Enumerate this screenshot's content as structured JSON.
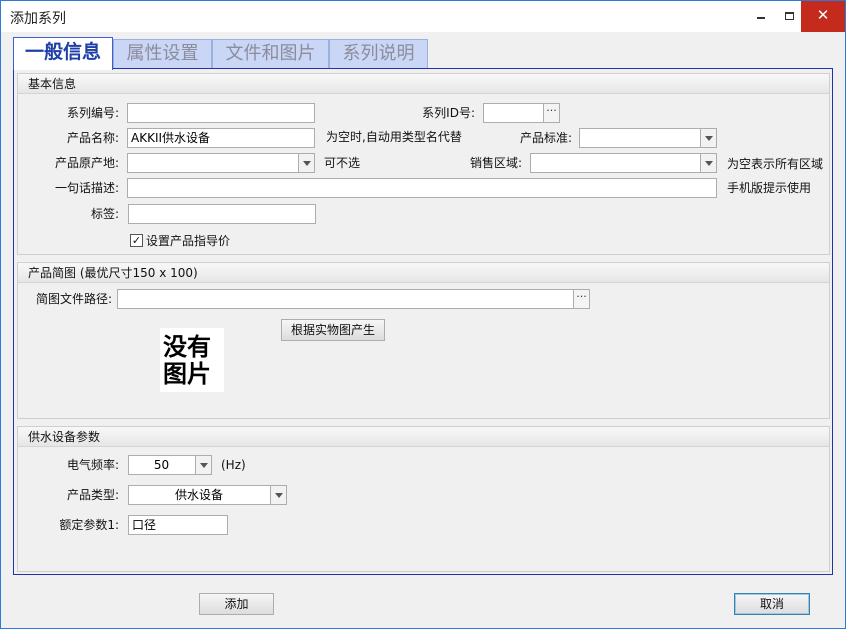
{
  "window": {
    "title": "添加系列",
    "close_glyph": "✕"
  },
  "tabs": [
    {
      "label": "一般信息",
      "active": true
    },
    {
      "label": "属性设置",
      "active": false
    },
    {
      "label": "文件和图片",
      "active": false
    },
    {
      "label": "系列说明",
      "active": false
    }
  ],
  "basic_info": {
    "header": "基本信息",
    "series_code_label": "系列编号:",
    "series_code_value": "",
    "series_id_label": "系列ID号:",
    "series_id_value": "",
    "product_name_label": "产品名称:",
    "product_name_value": "AKKII供水设备",
    "product_name_hint": "为空时,自动用类型名代替",
    "product_standard_label": "产品标准:",
    "product_standard_value": "",
    "origin_label": "产品原产地:",
    "origin_value": "",
    "origin_hint": "可不选",
    "sales_region_label": "销售区域:",
    "sales_region_value": "",
    "sales_region_hint": "为空表示所有区域",
    "one_line_label": "一句话描述:",
    "one_line_value": "",
    "one_line_hint": "手机版提示使用",
    "tag_label": "标签:",
    "tag_value": "",
    "guide_price_label": "设置产品指导价",
    "guide_price_checked": true,
    "check_glyph": "✓",
    "ellipsis": "···"
  },
  "thumbnail": {
    "header": "产品简图 (最优尺寸150 x 100)",
    "path_label": "简图文件路径:",
    "path_value": "",
    "generate_button": "根据实物图产生",
    "placeholder_line1": "没有",
    "placeholder_line2": "图片"
  },
  "water_params": {
    "header": "供水设备参数",
    "frequency_label": "电气频率:",
    "frequency_value": "50",
    "frequency_unit": "(Hz)",
    "product_type_label": "产品类型:",
    "product_type_value": "供水设备",
    "rated_param_label": "额定参数1:",
    "rated_param_value": "口径"
  },
  "footer": {
    "add_button": "添加",
    "cancel_button": "取消"
  }
}
